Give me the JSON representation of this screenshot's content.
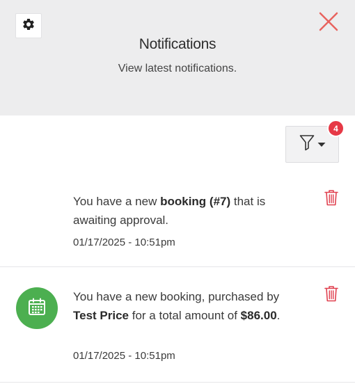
{
  "header": {
    "title": "Notifications",
    "subtitle": "View latest notifications."
  },
  "filter": {
    "badge_count": "4"
  },
  "notifications": [
    {
      "text_1": "You have a new ",
      "bold_1": "booking (#7)",
      "text_2": " that is awaiting approval.",
      "time": "01/17/2025 - 10:51pm"
    },
    {
      "text_1": "You have a new booking, purchased by ",
      "bold_1": "Test Price",
      "text_2": " for a total amount of ",
      "bold_2": "$86.00",
      "text_3": ".",
      "time": "01/17/2025 - 10:51pm",
      "icon": "calendar-icon"
    }
  ],
  "colors": {
    "header_bg": "#ededee",
    "close": "#e8635e",
    "trash": "#e0404f",
    "badge": "#e63946",
    "avatar": "#4caf50"
  }
}
